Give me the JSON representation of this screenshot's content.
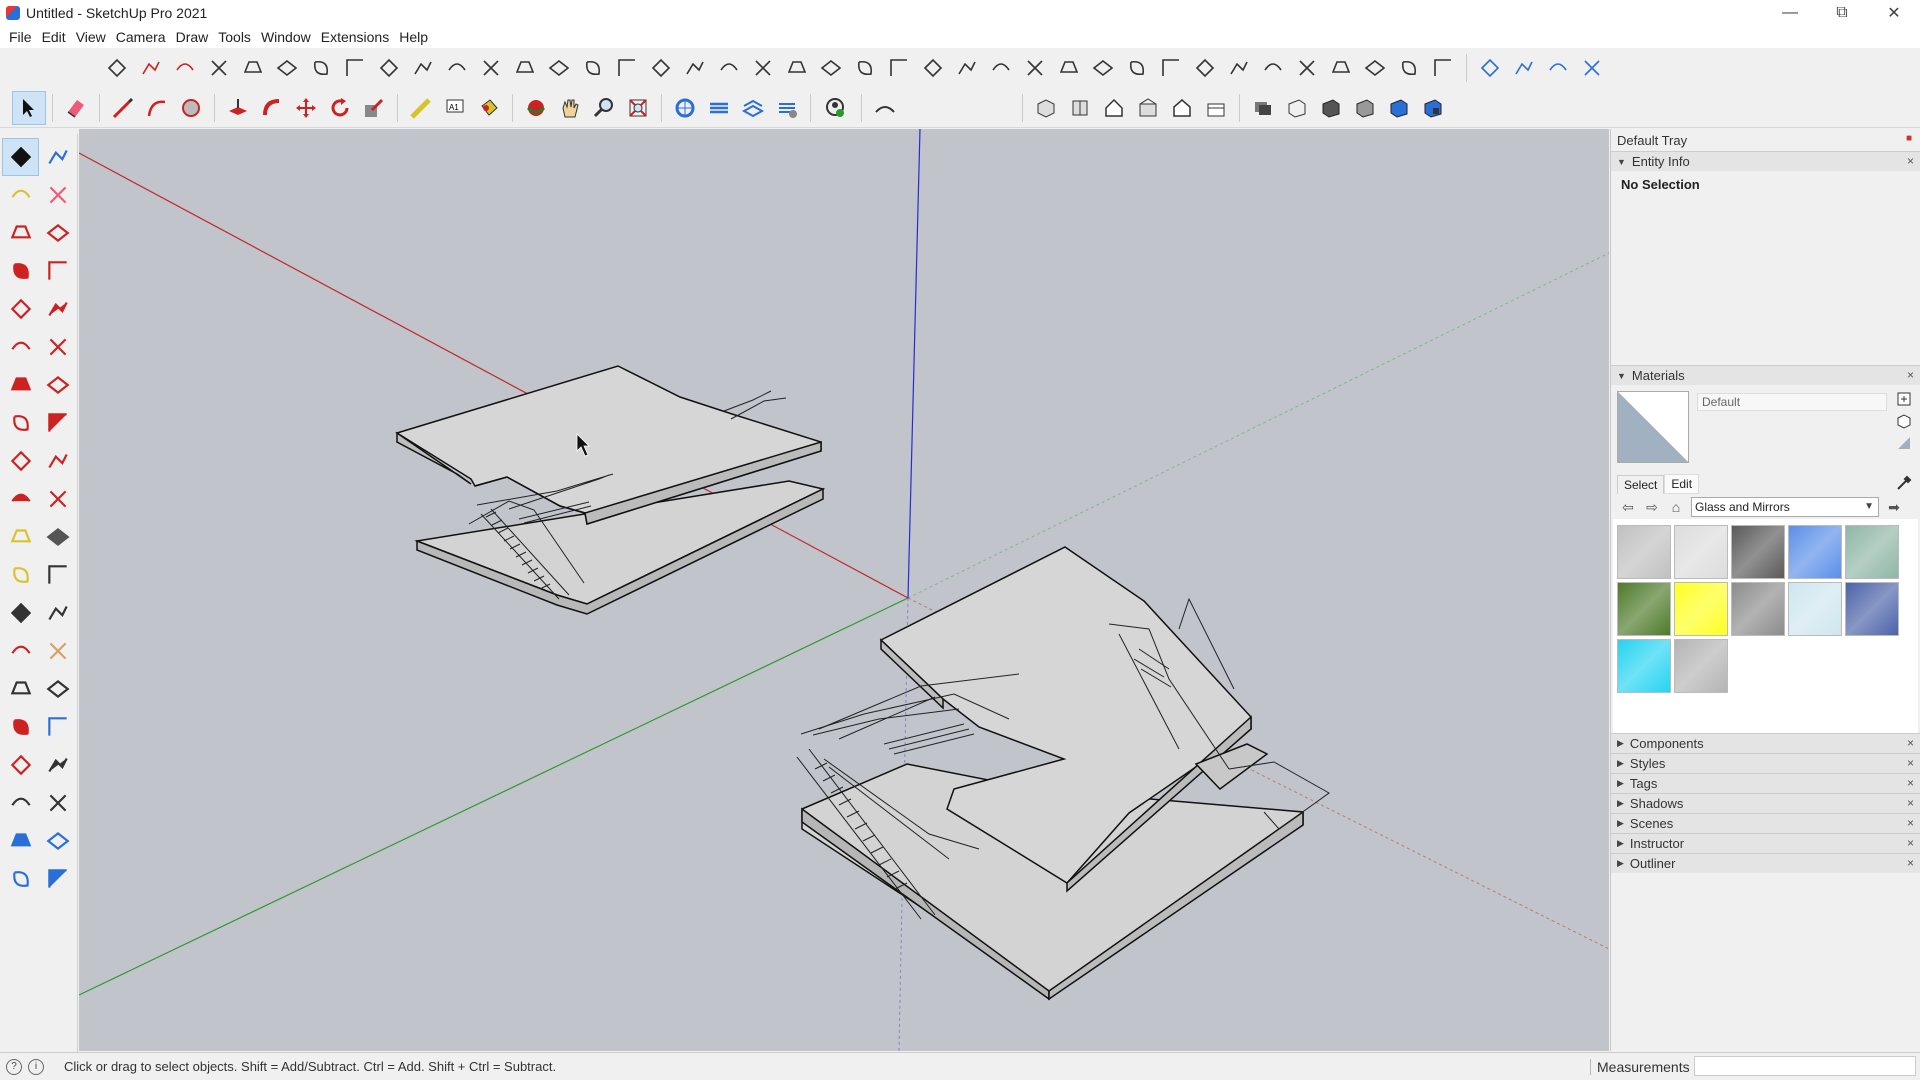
{
  "window": {
    "title": "Untitled - SketchUp Pro 2021",
    "controls": [
      "minimize-icon",
      "restore-icon",
      "close-icon"
    ]
  },
  "menu": [
    "File",
    "Edit",
    "View",
    "Camera",
    "Draw",
    "Tools",
    "Window",
    "Extensions",
    "Help"
  ],
  "toolbar_top_icons": 44,
  "toolbar_second": {
    "groups": [
      "select",
      "eraser",
      "pencil",
      "arc",
      "circle",
      "pushpull",
      "followme",
      "move",
      "rotate",
      "scale",
      "tape",
      "text",
      "paint",
      "orbit",
      "pan",
      "zoom",
      "zoom-extents",
      "warehouse",
      "ext-warehouse",
      "layout",
      "ext-manager",
      "profile",
      "sandbox",
      "views",
      "styles"
    ]
  },
  "tray": {
    "title": "Default Tray",
    "entity_info": {
      "title": "Entity Info",
      "text": "No Selection"
    },
    "materials": {
      "title": "Materials",
      "name": "Default",
      "tabs": [
        "Select",
        "Edit"
      ],
      "library": "Glass and Mirrors",
      "swatches": [
        "#c0c0c0",
        "#dcdcdc",
        "#5a5a5a",
        "#5b8fe8",
        "#8fb6a6",
        "#4e7a2a",
        "#ffff22",
        "#8c8c8c",
        "#cfe6ef",
        "#4b63a8",
        "#27d3f2",
        "#b4b4b4"
      ]
    },
    "panels": [
      "Components",
      "Styles",
      "Tags",
      "Shadows",
      "Scenes",
      "Instructor",
      "Outliner"
    ]
  },
  "status": {
    "hint": "Click or drag to select objects. Shift = Add/Subtract. Ctrl = Add. Shift + Ctrl = Subtract.",
    "measurements_label": "Measurements",
    "measurements_value": ""
  },
  "colors": {
    "viewport": "#c2c4cb",
    "axis_red": "#c02828",
    "axis_green": "#2f9a30",
    "axis_blue": "#2a2ad0"
  }
}
